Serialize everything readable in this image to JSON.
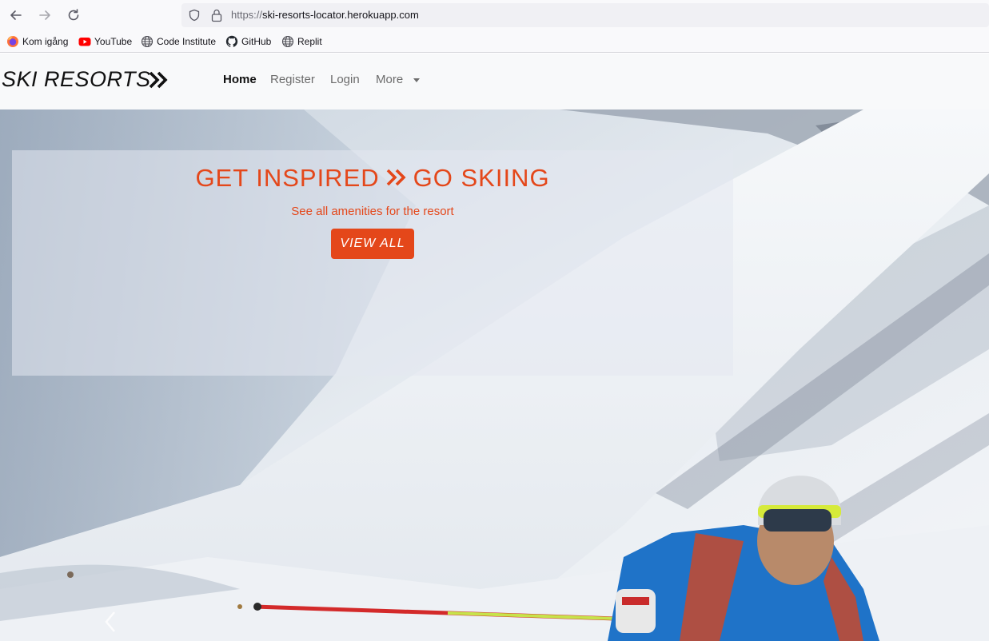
{
  "browser": {
    "url_scheme": "https://",
    "url_host": "ski-resorts-locator.herokuapp.com",
    "nav_back_icon": "arrow-left-icon",
    "nav_forward_icon": "arrow-right-icon",
    "reload_icon": "reload-icon",
    "bookmarks": [
      {
        "label": "Kom igång",
        "icon": "firefox-icon"
      },
      {
        "label": "YouTube",
        "icon": "youtube-icon"
      },
      {
        "label": "Code Institute",
        "icon": "globe-icon"
      },
      {
        "label": "GitHub",
        "icon": "github-icon"
      },
      {
        "label": "Replit",
        "icon": "globe-icon"
      }
    ]
  },
  "navbar": {
    "brand": "SKI RESORTS",
    "links": [
      {
        "label": "Home",
        "active": true
      },
      {
        "label": "Register",
        "active": false
      },
      {
        "label": "Login",
        "active": false
      },
      {
        "label": "More",
        "active": false,
        "dropdown": true
      }
    ]
  },
  "hero": {
    "headline_left": "GET INSPIRED",
    "headline_right": "GO SKIING",
    "subline": "See all amenities for the resort",
    "button_label": "VIEW ALL"
  },
  "colors": {
    "accent": "#e4471a",
    "navbar_bg": "#f8f9fa"
  }
}
